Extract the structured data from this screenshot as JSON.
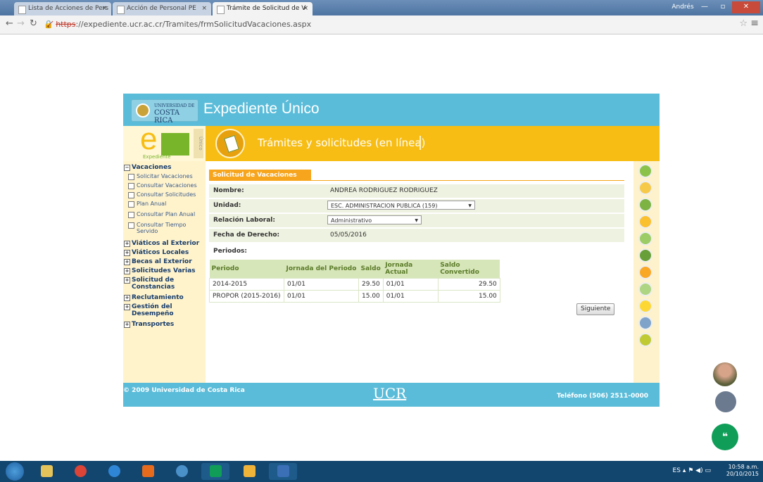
{
  "browser": {
    "tabs": [
      {
        "title": "Lista de Acciones de Pers"
      },
      {
        "title": "Acción de Personal PE"
      },
      {
        "title": "Trámite de Solicitud de V"
      }
    ],
    "window_user": "Andrés",
    "url_scheme": "https",
    "url_rest": "://expediente.ucr.ac.cr/Tramites/frmSolicitudVacaciones.aspx"
  },
  "site": {
    "logo_small": "UNIVERSIDAD DE",
    "logo_big": "COSTA RICA",
    "title": "Expediente Único",
    "eu_label": "Expediente",
    "eu_unico": "Único",
    "section_title": "Trámites y solicitudes (en línea)"
  },
  "sidebar": {
    "vacaciones": "Vacaciones",
    "sub": [
      "Solicitar Vacaciones",
      "Consultar Vacaciones",
      "Consultar Solicitudes",
      "Plan Anual",
      "Consultar Plan Anual",
      "Consultar Tiempo Servido"
    ],
    "groups": [
      "Viáticos al Exterior",
      "Viáticos Locales",
      "Becas al Exterior",
      "Solicitudes Varias",
      "Solicitud de Constancias",
      "Reclutamiento",
      "Gestión del Desempeño",
      "Transportes"
    ]
  },
  "form": {
    "tab_title": "Solicitud de Vacaciones",
    "nombre_label": "Nombre:",
    "nombre_value": "ANDREA RODRIGUEZ RODRIGUEZ",
    "unidad_label": "Unidad:",
    "unidad_value": "ESC. ADMINISTRACION PUBLICA (159)",
    "relacion_label": "Relación Laboral:",
    "relacion_value": "Administrativo",
    "fecha_label": "Fecha de Derecho:",
    "fecha_value": "05/05/2016",
    "periodos_label": "Periodos:",
    "table": {
      "headers": [
        "Periodo",
        "Jornada del Periodo",
        "Saldo",
        "Jornada Actual",
        "Saldo Convertido"
      ],
      "rows": [
        [
          "2014-2015",
          "01/01",
          "29.50",
          "01/01",
          "29.50"
        ],
        [
          "PROPOR (2015-2016)",
          "01/01",
          "15.00",
          "01/01",
          "15.00"
        ]
      ]
    },
    "next_button": "Siguiente"
  },
  "footer": {
    "copyright": "© 2009 Universidad de Costa Rica",
    "center_logo": "UCR",
    "phone": "Teléfono (506) 2511-0000"
  },
  "taskbar": {
    "lang": "ES",
    "time": "10:58 a.m.",
    "date": "20/10/2015"
  },
  "colors": {
    "header_blue": "#5bbcd9",
    "band_yellow": "#f7bd14",
    "tab_orange": "#f7a51c",
    "hangouts_green": "#0f9d58"
  }
}
